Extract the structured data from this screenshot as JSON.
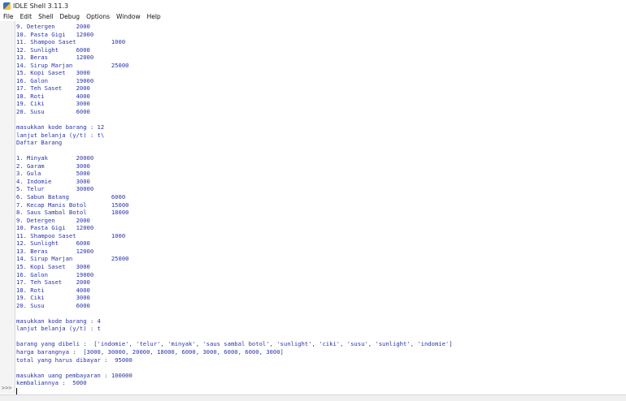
{
  "window": {
    "title": "IDLE Shell 3.11.3"
  },
  "menu": [
    "File",
    "Edit",
    "Shell",
    "Debug",
    "Options",
    "Window",
    "Help"
  ],
  "shell": {
    "prompt": ">>>",
    "lines": [
      "9. Detergen      2000",
      "10. Pasta Gigi   12000",
      "11. Shampoo Saset          1000",
      "12. Sunlight     6000",
      "13. Beras        12000",
      "14. Sirup Marjan           25000",
      "15. Kopi Saset   3000",
      "16. Galon        19000",
      "17. Teh Saset    2000",
      "18. Roti         4000",
      "19. Ciki         3000",
      "20. Susu         6000",
      "",
      "masukkan kode barang : 12",
      "lanjut belanja (y/t) : t\\",
      "Daftar Barang",
      "",
      "1. Minyak        20000",
      "2. Garam         3000",
      "3. Gula          5000",
      "4. Indomie       3000",
      "5. Telur         30000",
      "6. Sabun Batang            6000",
      "7. Kecap Manis Botol       15000",
      "8. Saus Sambal Botol       18000",
      "9. Detergen      2000",
      "10. Pasta Gigi   12000",
      "11. Shampoo Saset          1000",
      "12. Sunlight     6000",
      "13. Beras        12000",
      "14. Sirup Marjan           25000",
      "15. Kopi Saset   3000",
      "16. Galon        19000",
      "17. Teh Saset    2000",
      "18. Roti         4000",
      "19. Ciki         3000",
      "20. Susu         6000",
      "",
      "masukkan kode barang : 4",
      "lanjut belanja (y/t) : t",
      "",
      "barang yang dibeli :  ['indomie', 'telur', 'minyak', 'saus sambal botol', 'sunlight', 'ciki', 'susu', 'sunlight', 'indomie']",
      "harga barangnya :  [3000, 30000, 20000, 18000, 6000, 3000, 6000, 6000, 3000]",
      "total yang harus dibayar :  95000",
      "",
      "masukkan uang pembayaran : 100000",
      "kembaliannya :  5000"
    ]
  }
}
